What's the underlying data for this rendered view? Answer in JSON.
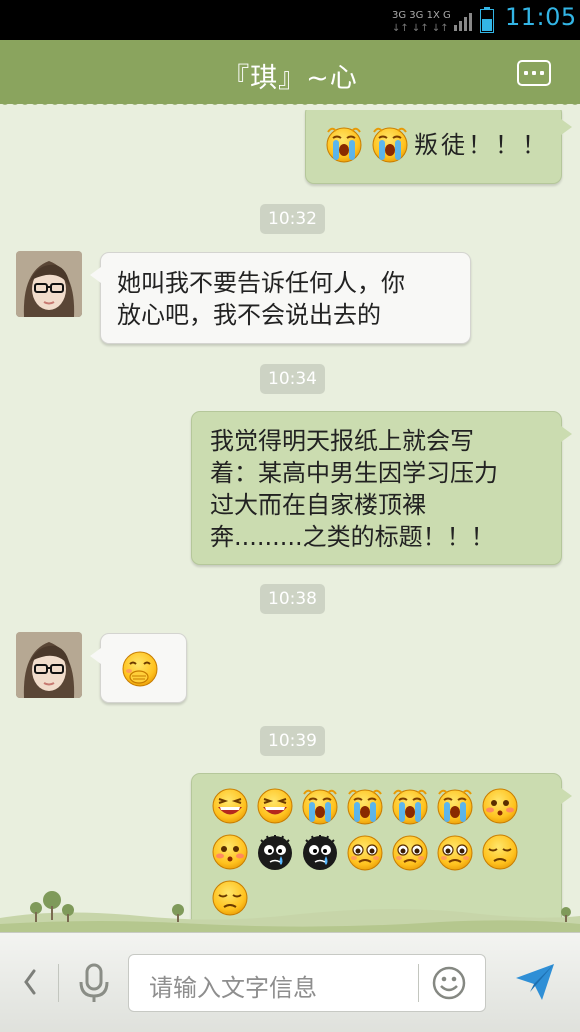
{
  "status_bar": {
    "network_labels": "3G 3G 1X G",
    "time": "11:05"
  },
  "header": {
    "title": "『琪』~心",
    "more_icon": "more-dots-icon"
  },
  "messages": [
    {
      "type": "outgoing",
      "emojis": [
        "crying",
        "crying"
      ],
      "text": "叛徒！！！"
    },
    {
      "type": "timestamp",
      "text": "10:32"
    },
    {
      "type": "incoming",
      "lines": [
        "她叫我不要告诉任何人，你",
        "放心吧，我不会说出去的"
      ]
    },
    {
      "type": "timestamp",
      "text": "10:34"
    },
    {
      "type": "outgoing",
      "lines": [
        "我觉得明天报纸上就会写",
        "着：某高中男生因学习压力",
        "过大而在自家楼顶裸",
        "奔.........之类的标题！！！"
      ]
    },
    {
      "type": "timestamp",
      "text": "10:38"
    },
    {
      "type": "incoming",
      "emojis": [
        "shy-giggle"
      ]
    },
    {
      "type": "timestamp",
      "text": "10:39"
    },
    {
      "type": "outgoing",
      "emojis": [
        "laughing",
        "laughing",
        "crying",
        "crying",
        "crying",
        "crying",
        "blush",
        "blush",
        "black-tear",
        "black-tear",
        "pleading",
        "pleading",
        "pleading",
        "sad",
        "sad"
      ]
    }
  ],
  "input_bar": {
    "placeholder": "请输入文字信息",
    "back_icon": "chevron-left-icon",
    "mic_icon": "microphone-icon",
    "emoji_icon": "smiley-icon",
    "send_icon": "send-icon"
  },
  "colors": {
    "title_bar": "#8aa45e",
    "chat_background": "#e9efde",
    "outgoing_bubble": "#cbdcb0",
    "incoming_bubble": "#f8f8f6",
    "clock": "#33b5e5"
  }
}
